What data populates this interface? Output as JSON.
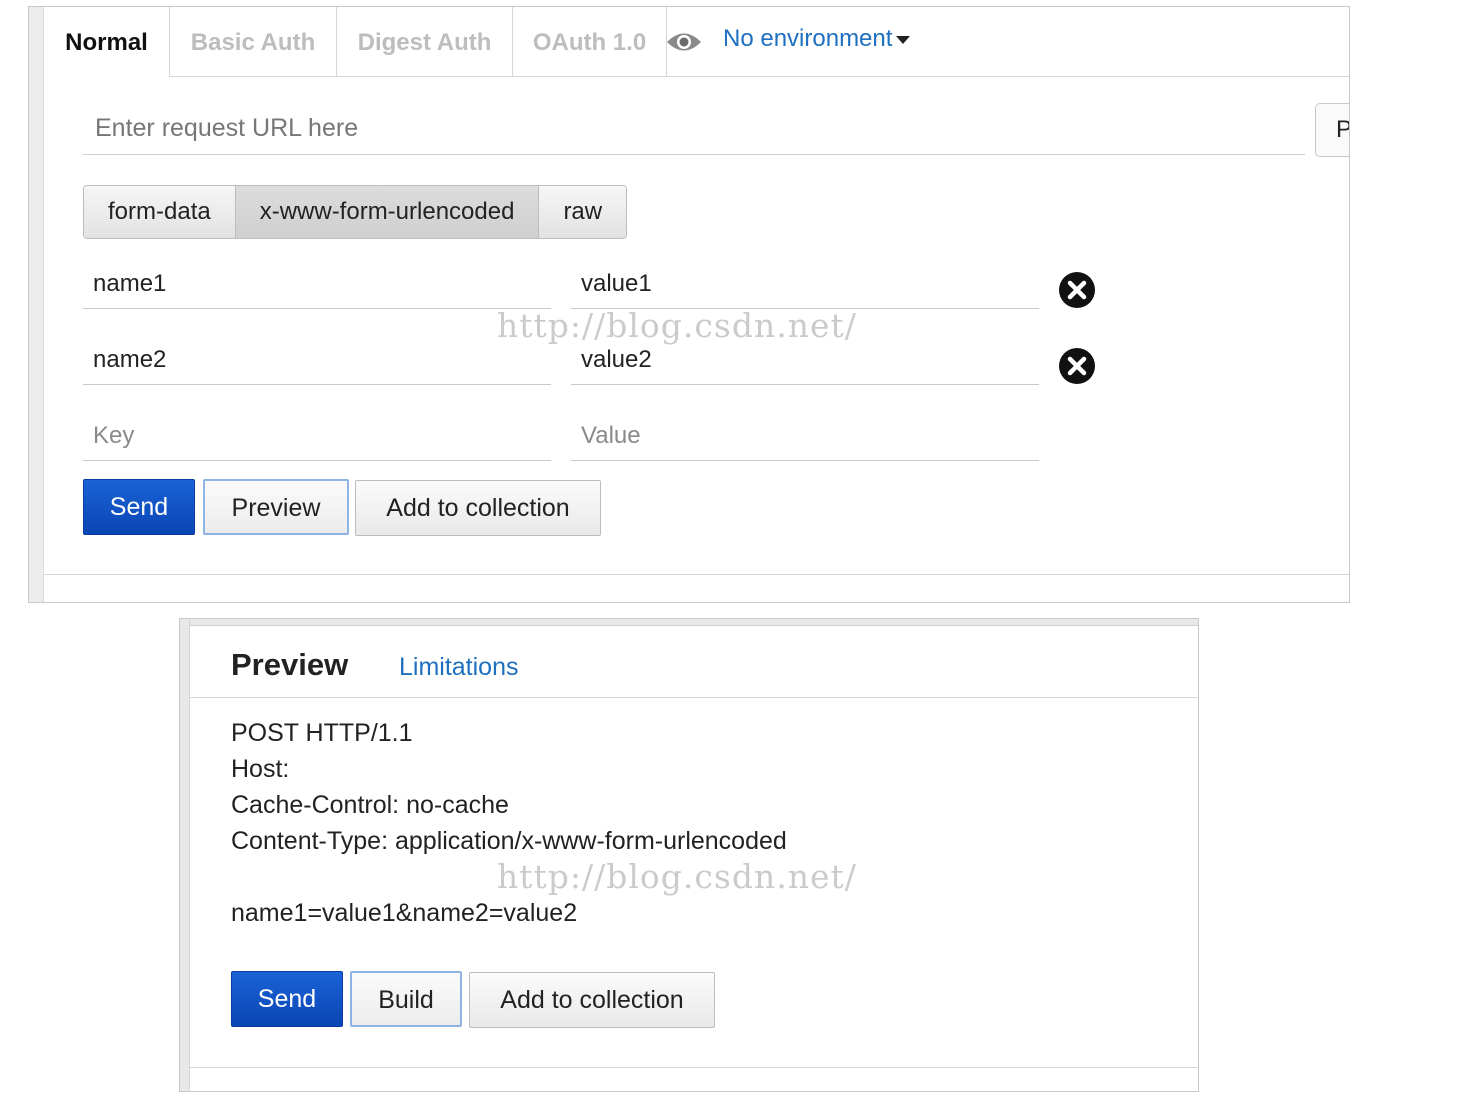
{
  "request": {
    "tabs": [
      "Normal",
      "Basic Auth",
      "Digest Auth",
      "OAuth 1.0"
    ],
    "environment": "No environment",
    "url_placeholder": "Enter request URL here",
    "params_button": "P",
    "body_modes": [
      "form-data",
      "x-www-form-urlencoded",
      "raw"
    ],
    "active_body_mode": "x-www-form-urlencoded",
    "rows": [
      {
        "key": "name1",
        "value": "value1"
      },
      {
        "key": "name2",
        "value": "value2"
      }
    ],
    "key_placeholder": "Key",
    "value_placeholder": "Value",
    "send_label": "Send",
    "preview_label": "Preview",
    "add_label": "Add to collection"
  },
  "watermark": "http://blog.csdn.net/",
  "preview": {
    "title": "Preview",
    "limitations": "Limitations",
    "lines": [
      "POST HTTP/1.1",
      "Host:",
      "Cache-Control: no-cache",
      "Content-Type: application/x-www-form-urlencoded"
    ],
    "body": "name1=value1&name2=value2",
    "send_label": "Send",
    "build_label": "Build",
    "add_label": "Add to collection"
  },
  "colors": {
    "primary": "#0a45b4",
    "link": "#1e6fbf"
  },
  "icons": [
    "eye-icon",
    "chevron-down-icon",
    "remove-icon"
  ]
}
